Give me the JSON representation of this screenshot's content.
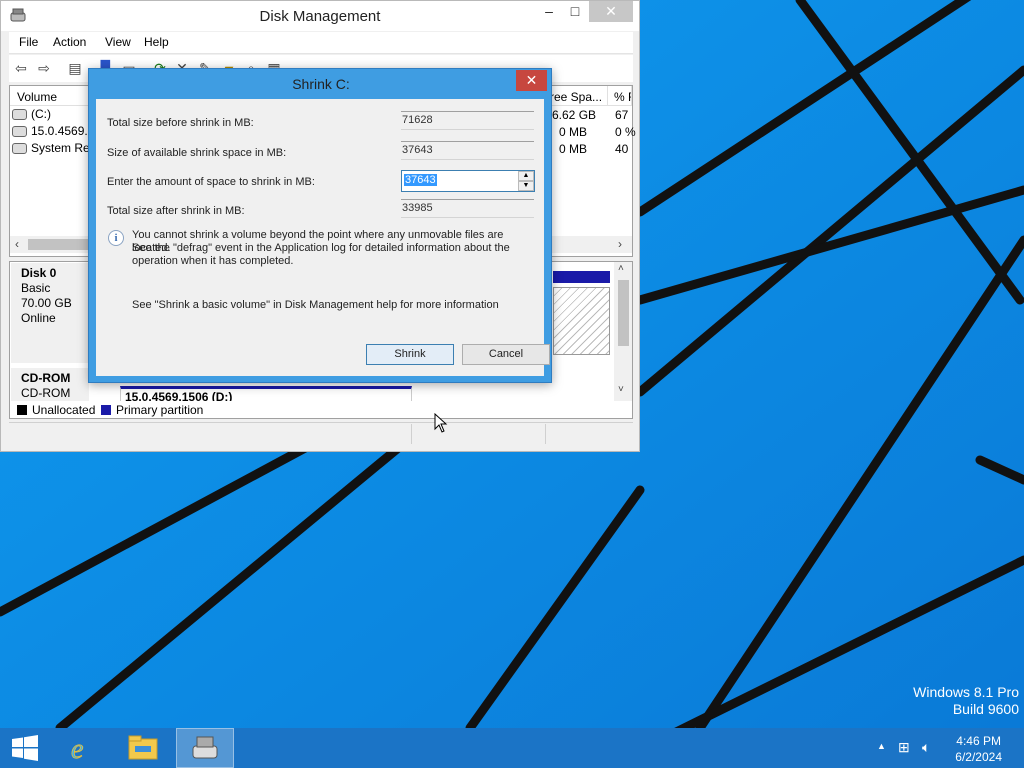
{
  "desktop": {
    "os_name": "Windows 8.1 Pro",
    "build": "Build 9600"
  },
  "window": {
    "title": "Disk Management",
    "menu": [
      "File",
      "Action",
      "View",
      "Help"
    ],
    "volume_list": {
      "columns": [
        "Volume",
        "ree Spa...",
        "% F"
      ],
      "rows": [
        {
          "name": "(C:)",
          "free": "6.62 GB",
          "pct": "67"
        },
        {
          "name": "15.0.4569.1",
          "free": "0 MB",
          "pct": "0 %"
        },
        {
          "name": "System Res",
          "free": "0 MB",
          "pct": "40"
        }
      ]
    },
    "disks": [
      {
        "name": "Disk 0",
        "type": "Basic",
        "size": "70.00 GB",
        "status": "Online"
      },
      {
        "name": "CD-ROM",
        "type": "CD-ROM"
      }
    ],
    "cdrom_volume": "15.0.4569.1506 (D:)",
    "legend": {
      "unallocated": "Unallocated",
      "unallocated_color": "#000000",
      "primary": "Primary partition",
      "primary_color": "#1a1aa8"
    }
  },
  "dialog": {
    "title": "Shrink C:",
    "fields": {
      "total_before_label": "Total size before shrink in MB:",
      "total_before_value": "71628",
      "available_label": "Size of available shrink space in MB:",
      "available_value": "37643",
      "amount_label": "Enter the amount of space to shrink in MB:",
      "amount_value": "37643",
      "total_after_label": "Total size after shrink in MB:",
      "total_after_value": "33985"
    },
    "info_text_1": "You cannot shrink a volume beyond the point where any unmovable files are located.",
    "info_text_2": "See the \"defrag\" event in the Application log for detailed information about the",
    "info_text_3": "operation when it has completed.",
    "help_text": "See \"Shrink a basic volume\" in Disk Management help for more information",
    "shrink_label": "Shrink",
    "cancel_label": "Cancel"
  },
  "taskbar": {
    "time": "4:46 PM",
    "date": "6/2/2024",
    "icons": [
      "windows-start-icon",
      "internet-explorer-icon",
      "file-explorer-icon",
      "disk-management-icon"
    ]
  }
}
